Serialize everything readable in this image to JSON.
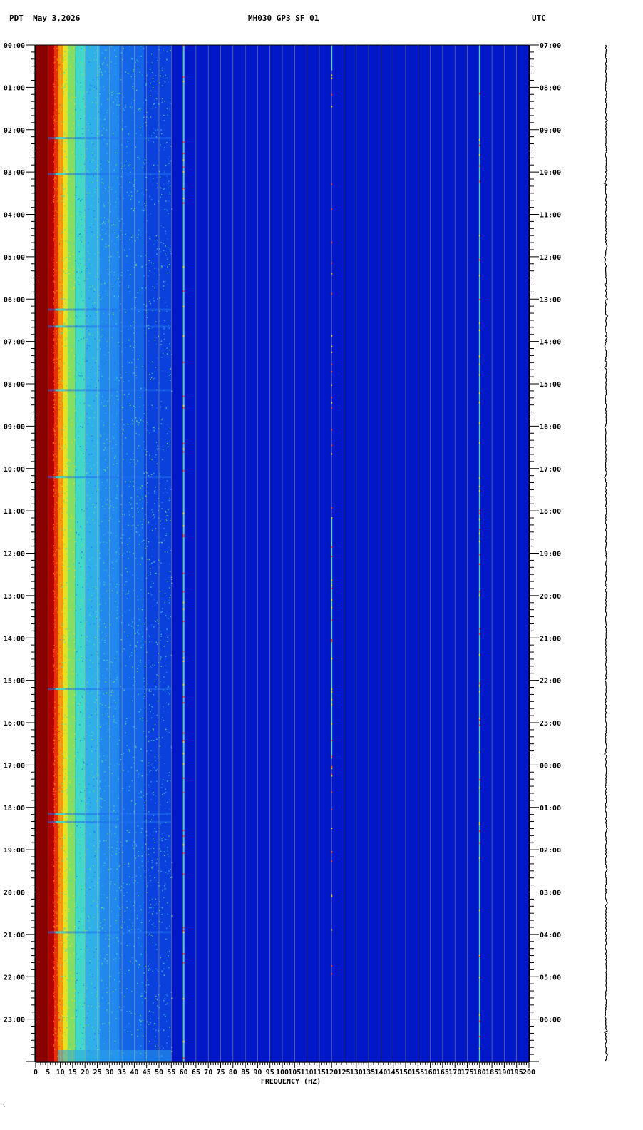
{
  "header": {
    "left": "PDT  May 3,2026",
    "center": "MH030 GP3 SF 01",
    "right": "UTC"
  },
  "chart_data": {
    "type": "heatmap",
    "title": "MH030 GP3 SF 01",
    "date": "May 3,2026",
    "left_timezone": "PDT",
    "right_timezone": "UTC",
    "xlabel": "FREQUENCY (HZ)",
    "xlim": [
      0,
      200
    ],
    "x_ticks": [
      "0",
      "5",
      "10",
      "15",
      "20",
      "25",
      "30",
      "35",
      "40",
      "45",
      "50",
      "55",
      "60",
      "65",
      "70",
      "75",
      "80",
      "85",
      "90",
      "95",
      "100",
      "105",
      "110",
      "115",
      "120",
      "125",
      "130",
      "135",
      "140",
      "145",
      "150",
      "155",
      "160",
      "165",
      "170",
      "175",
      "180",
      "185",
      "190",
      "195",
      "200"
    ],
    "y_ticks_left": [
      "00:00",
      "01:00",
      "02:00",
      "03:00",
      "04:00",
      "05:00",
      "06:00",
      "07:00",
      "08:00",
      "09:00",
      "10:00",
      "11:00",
      "12:00",
      "13:00",
      "14:00",
      "15:00",
      "16:00",
      "17:00",
      "18:00",
      "19:00",
      "20:00",
      "21:00",
      "22:00",
      "23:00"
    ],
    "y_ticks_right": [
      "07:00",
      "08:00",
      "09:00",
      "10:00",
      "11:00",
      "12:00",
      "13:00",
      "14:00",
      "15:00",
      "16:00",
      "17:00",
      "18:00",
      "19:00",
      "20:00",
      "21:00",
      "22:00",
      "23:00",
      "00:00",
      "01:00",
      "02:00",
      "03:00",
      "04:00",
      "05:00",
      "06:00"
    ],
    "hours_span": 24,
    "colorscale": [
      "#8b0000",
      "#e00000",
      "#ff8000",
      "#ffe000",
      "#40e0d0",
      "#1e90ff",
      "#0030e0",
      "#0000b0"
    ],
    "spectral_lines_hz": [
      60,
      120,
      180
    ],
    "grid_vertical": true,
    "bands": [
      {
        "f0": 0,
        "f1": 5,
        "color": "#8b0000"
      },
      {
        "f0": 5,
        "f1": 7.5,
        "color": "#b40000"
      },
      {
        "f0": 7.5,
        "f1": 9,
        "color": "#e83000"
      },
      {
        "f0": 9,
        "f1": 11,
        "color": "#ff9000"
      },
      {
        "f0": 11,
        "f1": 13,
        "color": "#e8e020"
      },
      {
        "f0": 13,
        "f1": 16,
        "color": "#80e060"
      },
      {
        "f0": 16,
        "f1": 20,
        "color": "#40d8c8"
      },
      {
        "f0": 20,
        "f1": 26,
        "color": "#30b0e8"
      },
      {
        "f0": 26,
        "f1": 34,
        "color": "#2288ee"
      },
      {
        "f0": 34,
        "f1": 44,
        "color": "#1464e8"
      },
      {
        "f0": 44,
        "f1": 55,
        "color": "#0a40dc"
      },
      {
        "f0": 55,
        "f1": 200,
        "color": "#0018c8"
      }
    ],
    "noise_bursts_hours": [
      2.2,
      3.05,
      6.25,
      6.65,
      8.15,
      10.2,
      15.2,
      18.15,
      18.35,
      20.95
    ]
  }
}
